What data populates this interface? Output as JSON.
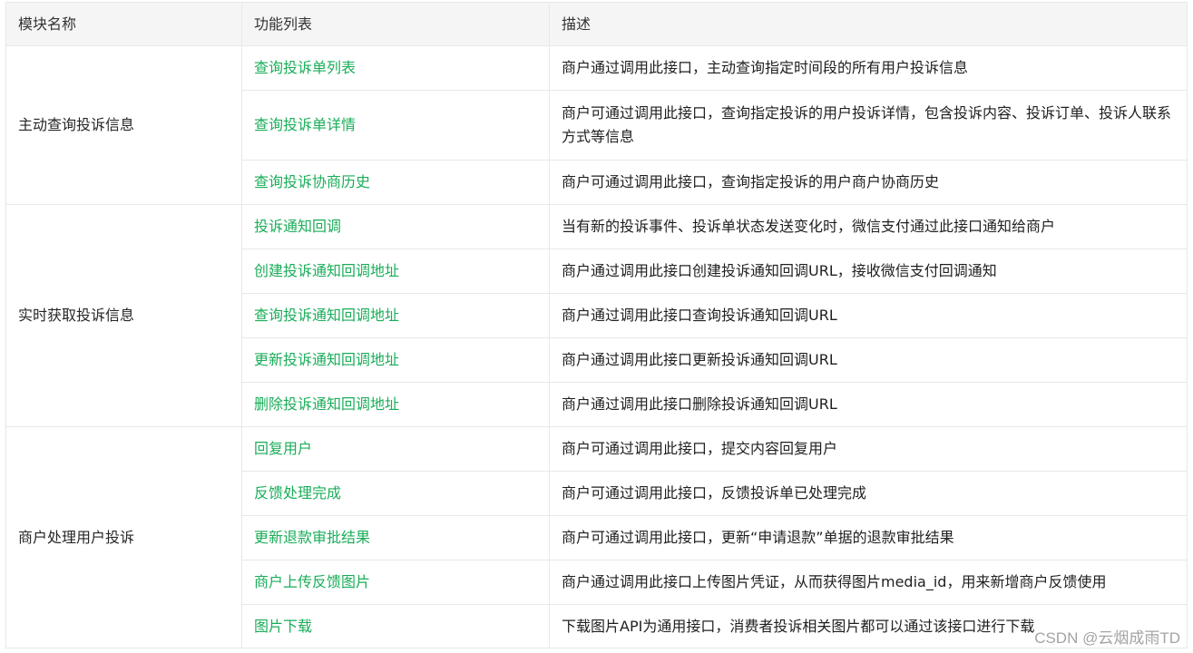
{
  "headers": {
    "module": "模块名称",
    "function": "功能列表",
    "description": "描述"
  },
  "groups": [
    {
      "module": "主动查询投诉信息",
      "rows": [
        {
          "function": "查询投诉单列表",
          "description": "商户通过调用此接口，主动查询指定时间段的所有用户投诉信息"
        },
        {
          "function": "查询投诉单详情",
          "description": "商户可通过调用此接口，查询指定投诉的用户投诉详情，包含投诉内容、投诉订单、投诉人联系方式等信息"
        },
        {
          "function": "查询投诉协商历史",
          "description": "商户可通过调用此接口，查询指定投诉的用户商户协商历史"
        }
      ]
    },
    {
      "module": "实时获取投诉信息",
      "rows": [
        {
          "function": "投诉通知回调",
          "description": "当有新的投诉事件、投诉单状态发送变化时，微信支付通过此接口通知给商户"
        },
        {
          "function": "创建投诉通知回调地址",
          "description": "商户通过调用此接口创建投诉通知回调URL，接收微信支付回调通知"
        },
        {
          "function": "查询投诉通知回调地址",
          "description": "商户通过调用此接口查询投诉通知回调URL"
        },
        {
          "function": "更新投诉通知回调地址",
          "description": "商户通过调用此接口更新投诉通知回调URL"
        },
        {
          "function": "删除投诉通知回调地址",
          "description": "商户通过调用此接口删除投诉通知回调URL"
        }
      ]
    },
    {
      "module": "商户处理用户投诉",
      "rows": [
        {
          "function": "回复用户",
          "description": "商户可通过调用此接口，提交内容回复用户"
        },
        {
          "function": "反馈处理完成",
          "description": "商户可通过调用此接口，反馈投诉单已处理完成"
        },
        {
          "function": "更新退款审批结果",
          "description": "商户可通过调用此接口，更新“申请退款”单据的退款审批结果"
        },
        {
          "function": "商户上传反馈图片",
          "description": "商户通过调用此接口上传图片凭证，从而获得图片media_id，用来新增商户反馈使用"
        },
        {
          "function": "图片下载",
          "description": "下载图片API为通用接口，消费者投诉相关图片都可以通过该接口进行下载"
        }
      ]
    }
  ],
  "watermark": "CSDN @云烟成雨TD",
  "colors": {
    "link": "#1aad59",
    "header_bg": "#f5f5f5",
    "border": "#e8e8e8"
  }
}
